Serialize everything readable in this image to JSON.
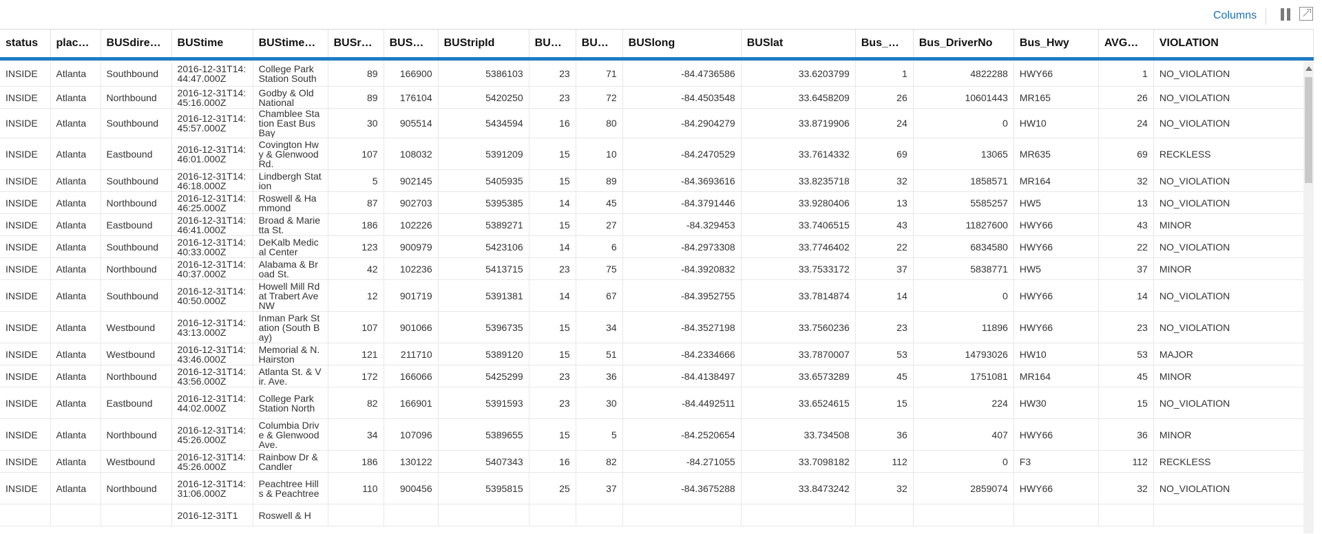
{
  "toolbar": {
    "columns_label": "Columns"
  },
  "columns": [
    "status",
    "plac…",
    "BUSdire…",
    "BUStime",
    "BUStime…",
    "BUSr…",
    "BUS…",
    "BUStripId",
    "BU…",
    "BU…",
    "BUSlong",
    "BUSlat",
    "Bus_…",
    "Bus_DriverNo",
    "Bus_Hwy",
    "AVG…",
    "VIOLATION"
  ],
  "rows": [
    [
      "INSIDE",
      "Atlanta",
      "Southbound",
      "2016-12-31T14:44:47.000Z",
      "College Park Station South",
      "89",
      "166900",
      "5386103",
      "23",
      "71",
      "-84.4736586",
      "33.6203799",
      "1",
      "4822288",
      "HWY66",
      "1",
      "NO_VIOLATION"
    ],
    [
      "INSIDE",
      "Atlanta",
      "Northbound",
      "2016-12-31T14:45:16.000Z",
      "Godby & Old National",
      "89",
      "176104",
      "5420250",
      "23",
      "72",
      "-84.4503548",
      "33.6458209",
      "26",
      "10601443",
      "MR165",
      "26",
      "NO_VIOLATION"
    ],
    [
      "INSIDE",
      "Atlanta",
      "Southbound",
      "2016-12-31T14:45:57.000Z",
      "Chamblee Station East Bus Bay",
      "30",
      "905514",
      "5434594",
      "16",
      "80",
      "-84.2904279",
      "33.8719906",
      "24",
      "0",
      "HW10",
      "24",
      "NO_VIOLATION"
    ],
    [
      "INSIDE",
      "Atlanta",
      "Eastbound",
      "2016-12-31T14:46:01.000Z",
      "Covington Hwy & Glenwood Rd.",
      "107",
      "108032",
      "5391209",
      "15",
      "10",
      "-84.2470529",
      "33.7614332",
      "69",
      "13065",
      "MR635",
      "69",
      "RECKLESS"
    ],
    [
      "INSIDE",
      "Atlanta",
      "Southbound",
      "2016-12-31T14:46:18.000Z",
      "Lindbergh Station",
      "5",
      "902145",
      "5405935",
      "15",
      "89",
      "-84.3693616",
      "33.8235718",
      "32",
      "1858571",
      "MR164",
      "32",
      "NO_VIOLATION"
    ],
    [
      "INSIDE",
      "Atlanta",
      "Northbound",
      "2016-12-31T14:46:25.000Z",
      "Roswell & Hammond",
      "87",
      "902703",
      "5395385",
      "14",
      "45",
      "-84.3791446",
      "33.9280406",
      "13",
      "5585257",
      "HW5",
      "13",
      "NO_VIOLATION"
    ],
    [
      "INSIDE",
      "Atlanta",
      "Eastbound",
      "2016-12-31T14:46:41.000Z",
      "Broad & Marietta St.",
      "186",
      "102226",
      "5389271",
      "15",
      "27",
      "-84.329453",
      "33.7406515",
      "43",
      "11827600",
      "HWY66",
      "43",
      "MINOR"
    ],
    [
      "INSIDE",
      "Atlanta",
      "Southbound",
      "2016-12-31T14:40:33.000Z",
      "DeKalb Medical Center",
      "123",
      "900979",
      "5423106",
      "14",
      "6",
      "-84.2973308",
      "33.7746402",
      "22",
      "6834580",
      "HWY66",
      "22",
      "NO_VIOLATION"
    ],
    [
      "INSIDE",
      "Atlanta",
      "Northbound",
      "2016-12-31T14:40:37.000Z",
      "Alabama & Broad St.",
      "42",
      "102236",
      "5413715",
      "23",
      "75",
      "-84.3920832",
      "33.7533172",
      "37",
      "5838771",
      "HW5",
      "37",
      "MINOR"
    ],
    [
      "INSIDE",
      "Atlanta",
      "Southbound",
      "2016-12-31T14:40:50.000Z",
      "Howell Mill Rd at Trabert Ave NW",
      "12",
      "901719",
      "5391381",
      "14",
      "67",
      "-84.3952755",
      "33.7814874",
      "14",
      "0",
      "HWY66",
      "14",
      "NO_VIOLATION"
    ],
    [
      "INSIDE",
      "Atlanta",
      "Westbound",
      "2016-12-31T14:43:13.000Z",
      "Inman Park Station (South Bay)",
      "107",
      "901066",
      "5396735",
      "15",
      "34",
      "-84.3527198",
      "33.7560236",
      "23",
      "11896",
      "HWY66",
      "23",
      "NO_VIOLATION"
    ],
    [
      "INSIDE",
      "Atlanta",
      "Westbound",
      "2016-12-31T14:43:46.000Z",
      "Memorial & N.Hairston",
      "121",
      "211710",
      "5389120",
      "15",
      "51",
      "-84.2334666",
      "33.7870007",
      "53",
      "14793026",
      "HW10",
      "53",
      "MAJOR"
    ],
    [
      "INSIDE",
      "Atlanta",
      "Northbound",
      "2016-12-31T14:43:56.000Z",
      "Atlanta St. & Vir. Ave.",
      "172",
      "166066",
      "5425299",
      "23",
      "36",
      "-84.4138497",
      "33.6573289",
      "45",
      "1751081",
      "MR164",
      "45",
      "MINOR"
    ],
    [
      "INSIDE",
      "Atlanta",
      "Eastbound",
      "2016-12-31T14:44:02.000Z",
      "College Park Station North",
      "82",
      "166901",
      "5391593",
      "23",
      "30",
      "-84.4492511",
      "33.6524615",
      "15",
      "224",
      "HW30",
      "15",
      "NO_VIOLATION"
    ],
    [
      "INSIDE",
      "Atlanta",
      "Northbound",
      "2016-12-31T14:45:26.000Z",
      "Columbia Drive & Glenwood Ave.",
      "34",
      "107096",
      "5389655",
      "15",
      "5",
      "-84.2520654",
      "33.734508",
      "36",
      "407",
      "HWY66",
      "36",
      "MINOR"
    ],
    [
      "INSIDE",
      "Atlanta",
      "Westbound",
      "2016-12-31T14:45:26.000Z",
      "Rainbow Dr & Candler",
      "186",
      "130122",
      "5407343",
      "16",
      "82",
      "-84.271055",
      "33.7098182",
      "112",
      "0",
      "F3",
      "112",
      "RECKLESS"
    ],
    [
      "INSIDE",
      "Atlanta",
      "Northbound",
      "2016-12-31T14:31:06.000Z",
      "Peachtree Hills & Peachtree",
      "110",
      "900456",
      "5395815",
      "25",
      "37",
      "-84.3675288",
      "33.8473242",
      "32",
      "2859074",
      "HWY66",
      "32",
      "NO_VIOLATION"
    ],
    [
      "",
      "",
      "",
      "2016-12-31T1",
      "Roswell & H",
      "",
      "",
      "",
      "",
      "",
      "",
      "",
      "",
      "",
      "",
      "",
      ""
    ]
  ]
}
